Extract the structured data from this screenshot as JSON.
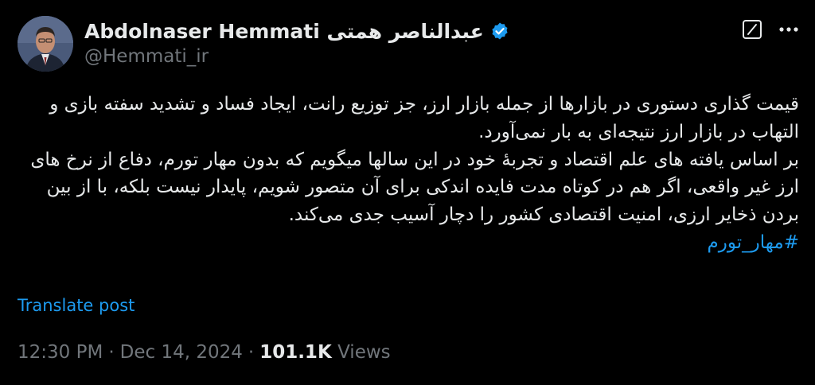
{
  "author": {
    "display_name": "Abdolnaser Hemmati عبدالناصر همتی",
    "handle": "@Hemmati_ir",
    "verified": true
  },
  "actions": {
    "grok_icon": "grok-icon",
    "more_icon": "more-icon"
  },
  "tweet": {
    "lines": [
      "قیمت گذاری دستوری در بازارها از جمله بازار ارز، جز توزیع رانت، ایجاد فساد و تشدید سفته بازی و",
      "التهاب در بازار ارز نتیجه‌ای به بار نمی‌آورد.",
      "بر اساس یافته های علم اقتصاد و تجربهٔ خود در این سالها میگویم که بدون مهار تورم، دفاع از نرخ های",
      "ارز غیر واقعی، اگر هم در کوتاه مدت فایده اندکی برای آن متصور شویم، پایدار نیست بلکه، با از بین",
      "بردن ذخایر ارزی، امنیت اقتصادی کشور را دچار آسیب جدی می‌کند."
    ],
    "hashtag": "#مهار_تورم"
  },
  "translate_label": "Translate post",
  "meta": {
    "time": "12:30 PM",
    "date": "Dec 14, 2024",
    "separator": "·",
    "views_count": "101.1K",
    "views_label": "Views"
  },
  "colors": {
    "background": "#000000",
    "text": "#e7e9ea",
    "muted": "#71767b",
    "link": "#1d9bf0"
  }
}
